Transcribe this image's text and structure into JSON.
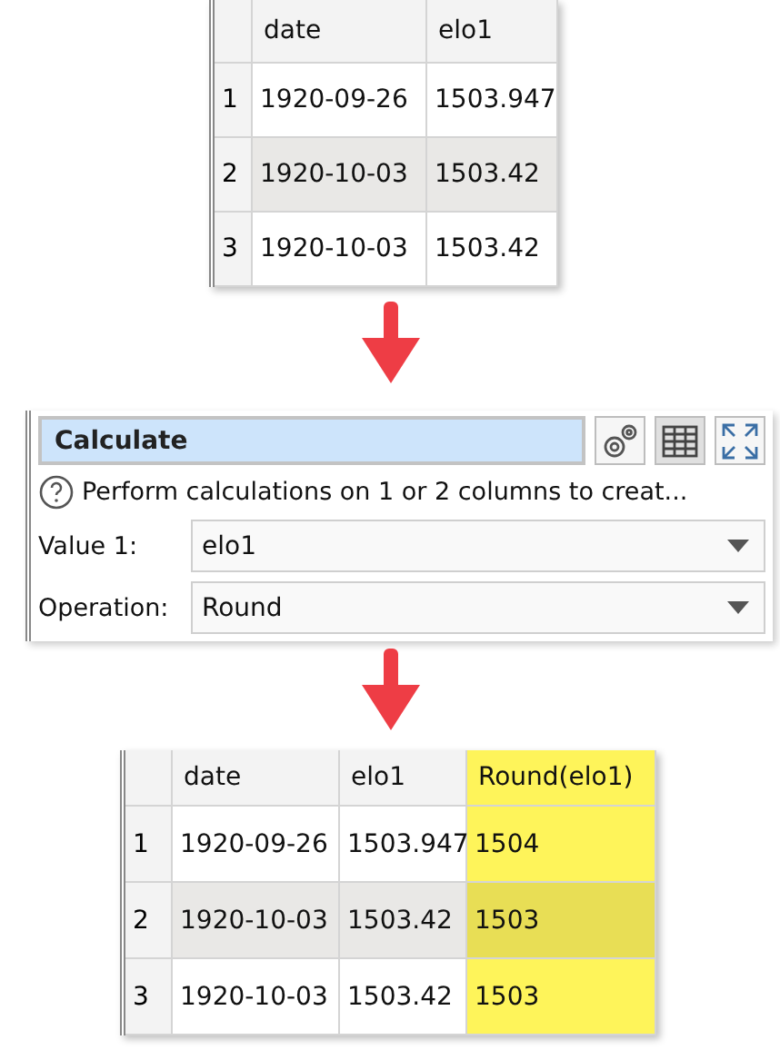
{
  "input_table": {
    "columns": [
      {
        "label": "date",
        "highlighted": false
      },
      {
        "label": "elo1",
        "highlighted": false
      }
    ],
    "rows": [
      {
        "index": "1",
        "cells": [
          "1920-09-26",
          "1503.947"
        ]
      },
      {
        "index": "2",
        "cells": [
          "1920-10-03",
          "1503.42"
        ]
      },
      {
        "index": "3",
        "cells": [
          "1920-10-03",
          "1503.42"
        ]
      }
    ]
  },
  "panel": {
    "title": "Calculate",
    "help": "Perform calculations on 1 or 2 columns to creat...",
    "fields": [
      {
        "label": "Value 1:",
        "value": "elo1"
      },
      {
        "label": "Operation:",
        "value": "Round"
      }
    ]
  },
  "output_table": {
    "columns": [
      {
        "label": "date",
        "highlighted": false
      },
      {
        "label": "elo1",
        "highlighted": false
      },
      {
        "label": "Round(elo1)",
        "highlighted": true
      }
    ],
    "rows": [
      {
        "index": "1",
        "cells": [
          "1920-09-26",
          "1503.947",
          "1504"
        ]
      },
      {
        "index": "2",
        "cells": [
          "1920-10-03",
          "1503.42",
          "1503"
        ]
      },
      {
        "index": "3",
        "cells": [
          "1920-10-03",
          "1503.42",
          "1503"
        ]
      }
    ]
  }
}
